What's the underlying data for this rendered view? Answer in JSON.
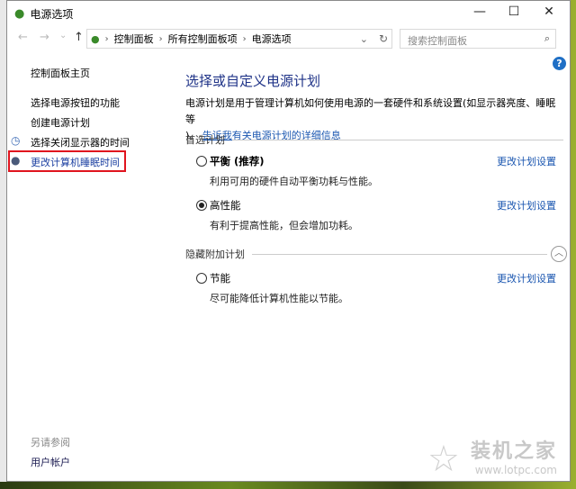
{
  "window": {
    "title": "电源选项",
    "minimize": "—",
    "maximize": "☐",
    "close": "✕"
  },
  "nav": {
    "back": "←",
    "forward": "→",
    "recent": "⌄",
    "up": "↑",
    "breadcrumb": [
      "控制面板",
      "所有控制面板项",
      "电源选项"
    ],
    "dropdown": "⌄",
    "refresh": "↻",
    "search_placeholder": "搜索控制面板",
    "search_icon": "⌕"
  },
  "sidebar": {
    "home": "控制面板主页",
    "items": [
      "选择电源按钮的功能",
      "创建电源计划",
      "选择关闭显示器的时间",
      "更改计算机睡眠时间"
    ],
    "see_also": "另请参阅",
    "user_accounts": "用户帐户"
  },
  "main": {
    "title": "选择或自定义电源计划",
    "desc": "电源计划是用于管理计算机如何使用电源的一套硬件和系统设置(如显示器亮度、睡眠等",
    "desc2": ")。",
    "link": "告诉我有关电源计划的详细信息",
    "preferred": "首选计划",
    "hidden": "隐藏附加计划",
    "change": "更改计划设置",
    "plans": [
      {
        "name": "平衡 (推荐)",
        "desc": "利用可用的硬件自动平衡功耗与性能。",
        "selected": false
      },
      {
        "name": "高性能",
        "desc": "有利于提高性能，但会增加功耗。",
        "selected": true
      },
      {
        "name": "节能",
        "desc": "尽可能降低计算机性能以节能。",
        "selected": false
      }
    ]
  },
  "help": "?",
  "watermark": {
    "name": "装机之家",
    "url": "www.lotpc.com"
  },
  "colors": {
    "link": "#1a56b0",
    "title": "#1e3287",
    "highlight": "#e0141e"
  }
}
